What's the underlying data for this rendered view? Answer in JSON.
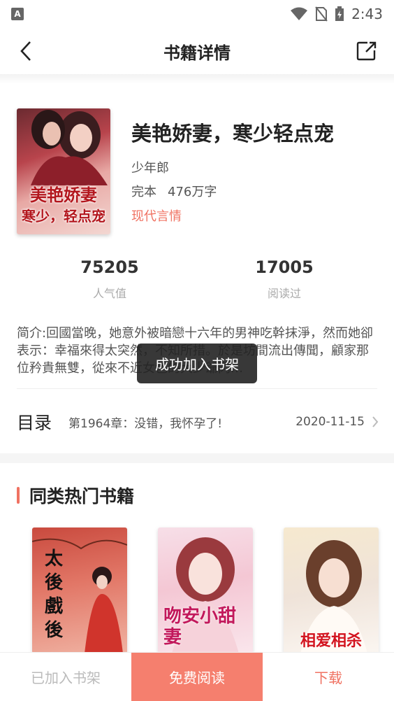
{
  "status_bar": {
    "time": "2:43",
    "app_badge": "A"
  },
  "nav": {
    "title": "书籍详情"
  },
  "book": {
    "cover_line1": "美艳娇妻",
    "cover_line2": "寒少，轻点宠",
    "title": "美艳娇妻，寒少轻点宠",
    "author": "少年郎",
    "status": "完本",
    "words": "476万字",
    "genre": "现代言情"
  },
  "stats": [
    {
      "value": "75205",
      "label": "人气值"
    },
    {
      "value": "17005",
      "label": "阅读过"
    }
  ],
  "synopsis": "简介:回國當晚，她意外被暗戀十六年的男神吃幹抹淨，然而她卻表示：幸福來得太突然，不知所措。於是坊間流出傳聞，顧家那位矜貴無雙，從來不近女色的大少爺閃…",
  "toc": {
    "label": "目录",
    "latest_chapter": "第1964章：没错，我怀孕了!",
    "date": "2020-11-15"
  },
  "recommend": {
    "title": "同类热门书籍",
    "covers": [
      {
        "text": "太後戲後"
      },
      {
        "text": "吻安小甜妻"
      },
      {
        "text": "相爱相杀"
      }
    ]
  },
  "toast": "成功加入书架",
  "bottom_bar": {
    "shelf": "已加入书架",
    "read": "免费阅读",
    "download": "下载"
  },
  "colors": {
    "accent": "#f07262",
    "read_button": "#f57f6e"
  }
}
